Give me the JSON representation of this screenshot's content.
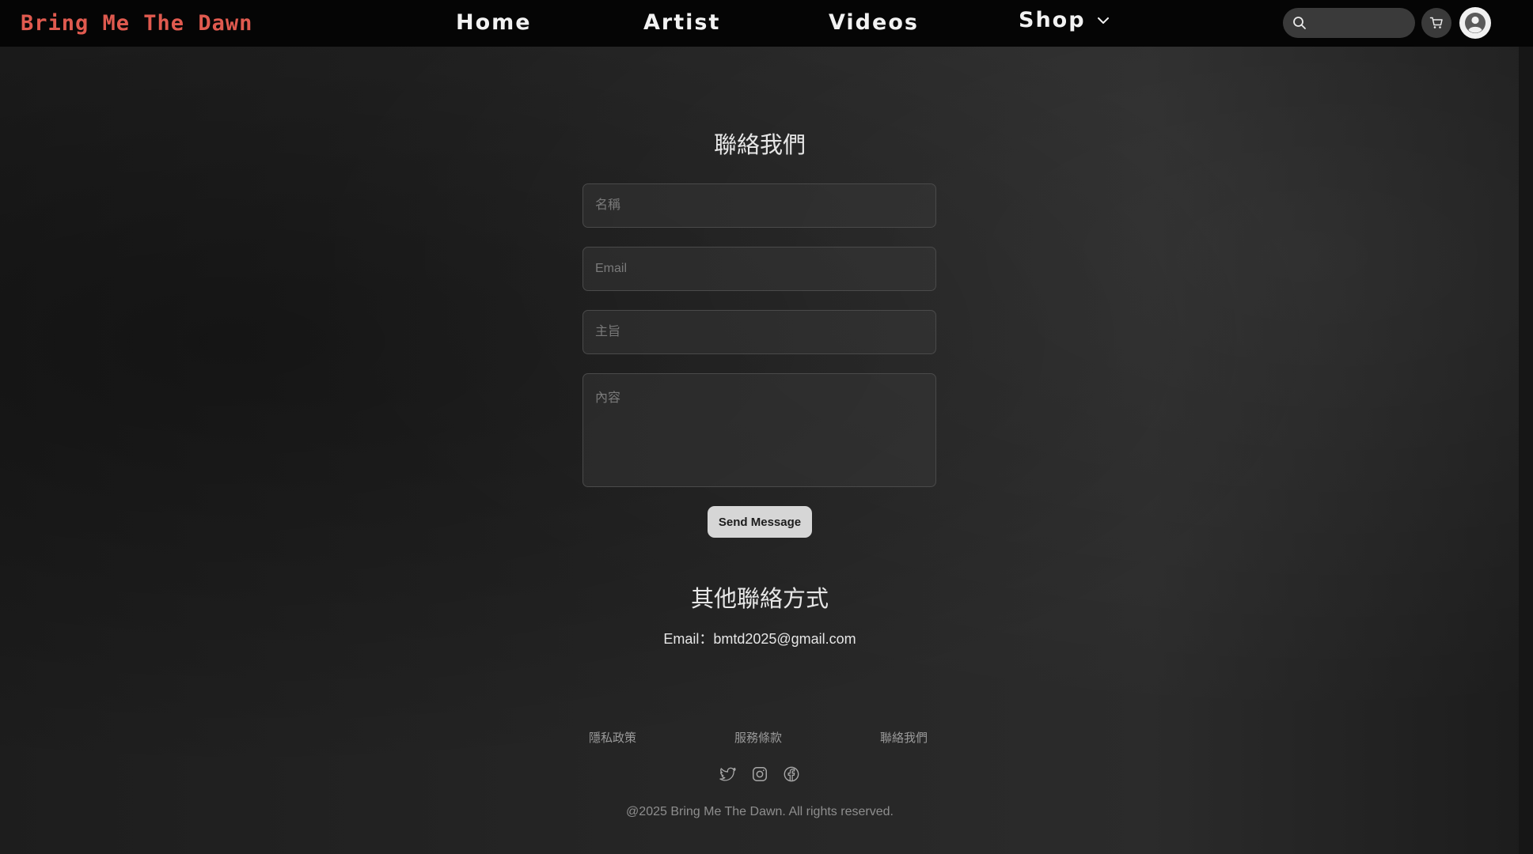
{
  "brand": {
    "name": "Bring Me The Dawn",
    "color": "#e05a4f"
  },
  "nav": {
    "home": "Home",
    "artist": "Artist",
    "videos": "Videos",
    "shop": "Shop",
    "search_placeholder": "",
    "icons": {
      "search": "search-icon",
      "cart": "cart-icon",
      "account": "user-avatar-icon",
      "shop_dropdown": "chevron-down-icon"
    }
  },
  "contact_form": {
    "title": "聯絡我們",
    "name_placeholder": "名稱",
    "email_placeholder": "Email",
    "subject_placeholder": "主旨",
    "content_placeholder": "內容",
    "submit_label": "Send Message"
  },
  "other_contact": {
    "title": "其他聯絡方式",
    "email_line": "Email：bmtd2025@gmail.com"
  },
  "footer": {
    "links": [
      "隱私政策",
      "服務條款",
      "聯絡我們"
    ],
    "social_icons": [
      "twitter-icon",
      "instagram-icon",
      "facebook-icon"
    ],
    "copyright": "@2025 Bring Me The Dawn. All rights reserved."
  }
}
